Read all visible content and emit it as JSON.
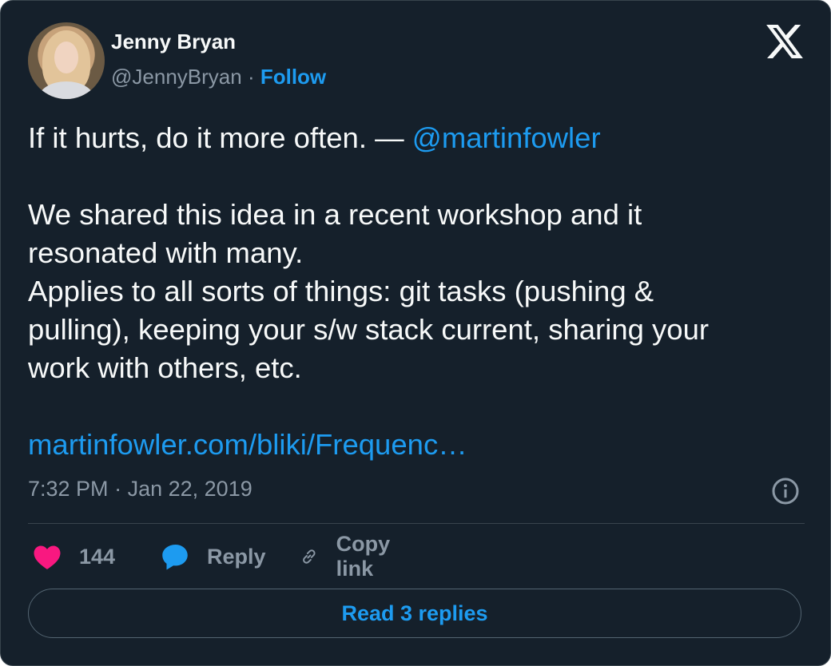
{
  "author": {
    "name": "Jenny Bryan",
    "handle": "@JennyBryan",
    "separator": "·",
    "follow_label": "Follow"
  },
  "tweet": {
    "line1_text": "If it hurts, do it more often. — ",
    "line1_mention": "@martinfowler",
    "line2": "We shared this idea in a recent workshop and it",
    "line3": "resonated with many.",
    "line4": "Applies to all sorts of things: git tasks (pushing &",
    "line5": "pulling), keeping your s/w stack current, sharing your",
    "line6": "work with others, etc.",
    "link": "martinfowler.com/bliki/Frequenc…"
  },
  "meta": {
    "time": "7:32 PM",
    "separator": "·",
    "date": "Jan 22, 2019"
  },
  "actions": {
    "like_count": "144",
    "reply_label": "Reply",
    "copy_label": "Copy link"
  },
  "read_replies_label": "Read 3 replies",
  "icons": {
    "logo": "x-logo-icon",
    "info": "info-icon",
    "like": "heart-icon",
    "reply": "speech-bubble-icon",
    "copy": "link-icon"
  },
  "colors": {
    "background": "#15202b",
    "accent": "#1d9bf0",
    "like": "#f91880",
    "muted": "#8b98a5",
    "text": "#f7f9f9"
  }
}
